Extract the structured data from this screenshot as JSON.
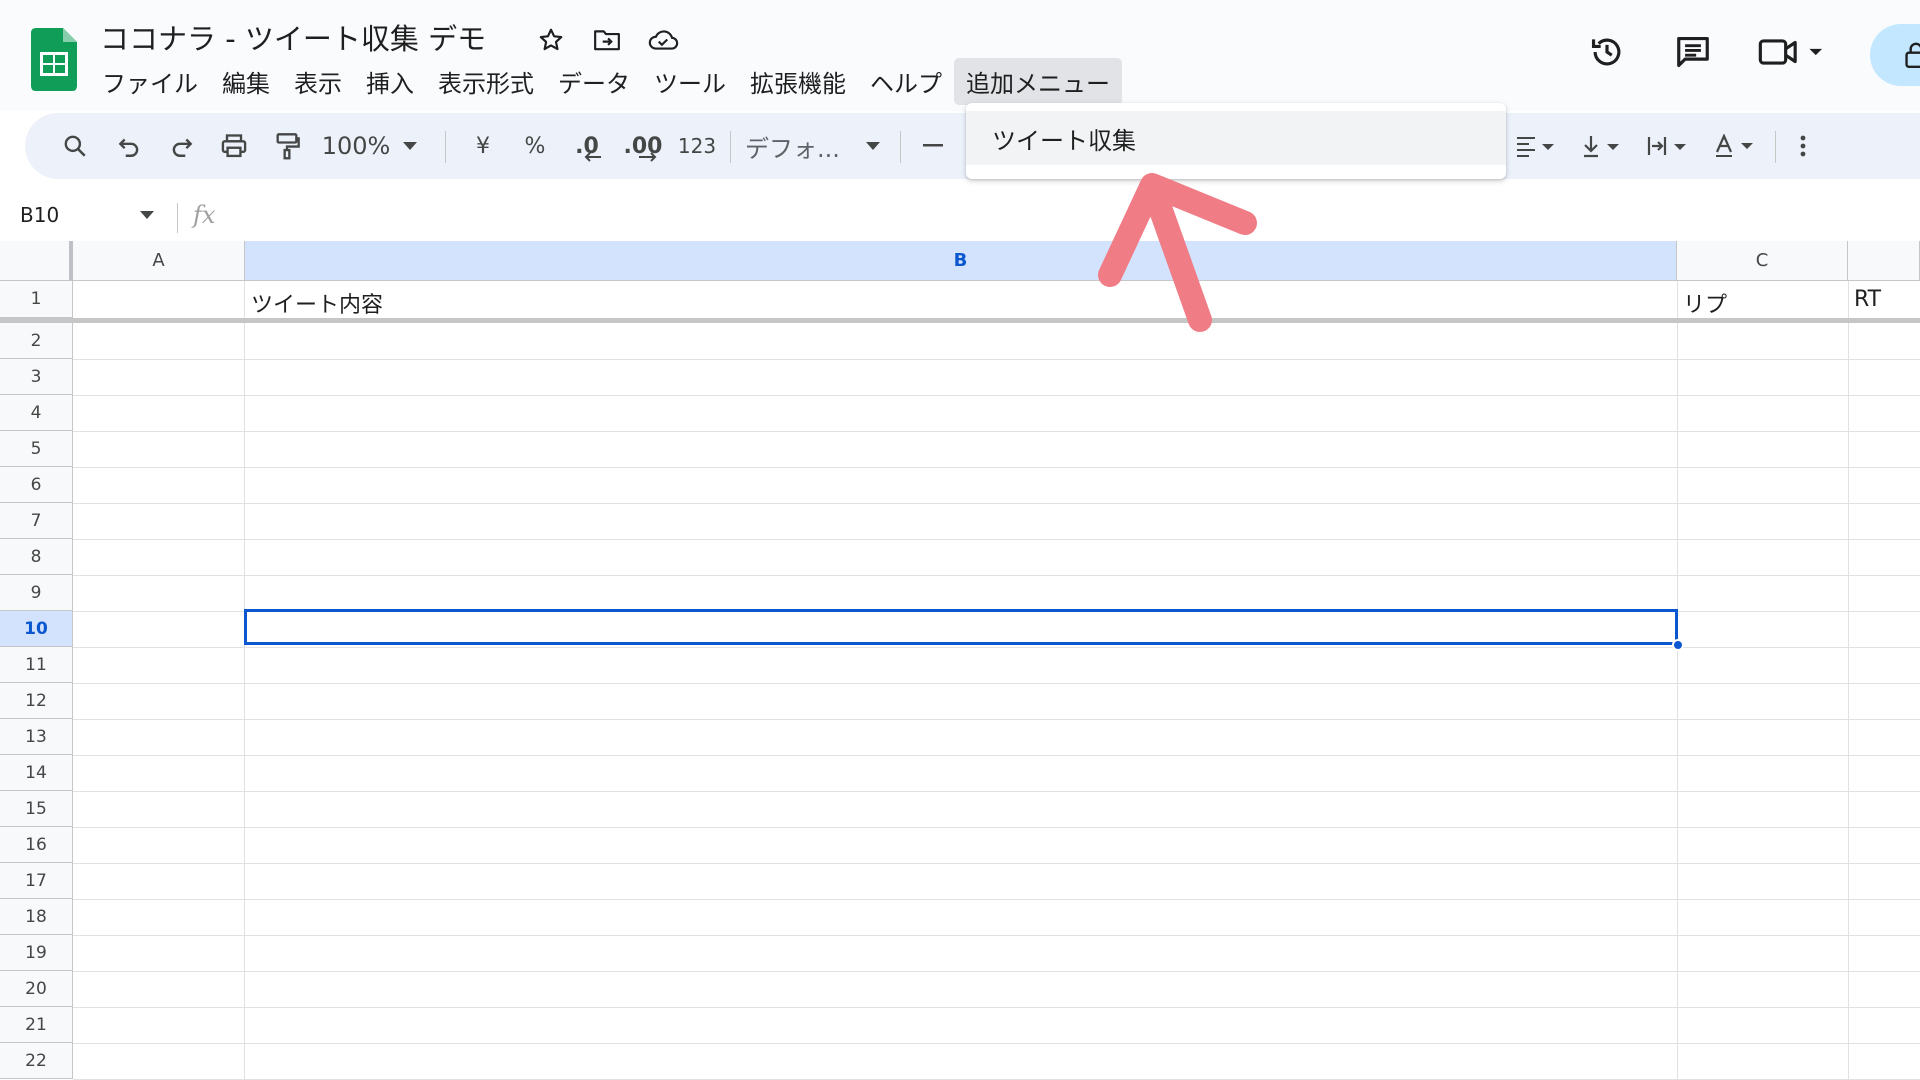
{
  "doc": {
    "title": "ココナラ - ツイート収集 デモ"
  },
  "menu": [
    {
      "label": "ファイル"
    },
    {
      "label": "編集"
    },
    {
      "label": "表示"
    },
    {
      "label": "挿入"
    },
    {
      "label": "表示形式"
    },
    {
      "label": "データ"
    },
    {
      "label": "ツール"
    },
    {
      "label": "拡張機能"
    },
    {
      "label": "ヘルプ"
    },
    {
      "label": "追加メニュー",
      "active": true
    }
  ],
  "dropdown": {
    "items": [
      {
        "label": "ツイート収集"
      }
    ]
  },
  "toolbar": {
    "zoom": "100%",
    "currency": "¥",
    "percent": "%",
    "decrease_decimal": ".0",
    "increase_decimal": ".00",
    "number_format": "123",
    "font": "デフォ..."
  },
  "formula_bar": {
    "cell_ref": "B10",
    "fx": "fx"
  },
  "columns": [
    {
      "label": "A"
    },
    {
      "label": "B",
      "selected": true
    },
    {
      "label": "C"
    },
    {
      "label": ""
    }
  ],
  "rows": [
    "1",
    "2",
    "3",
    "4",
    "5",
    "6",
    "7",
    "8",
    "9",
    "10",
    "11",
    "12",
    "13",
    "14",
    "15",
    "16",
    "17",
    "18",
    "19",
    "20",
    "21",
    "22"
  ],
  "selected_row": "10",
  "cells": {
    "B1": "ツイート内容",
    "C1": "リプ",
    "D1": "RT"
  },
  "colors": {
    "accent": "#0b57d0",
    "selection_header": "#d3e3fd",
    "sheets_green": "#0f9d58",
    "annotation_arrow": "#f07c86"
  }
}
